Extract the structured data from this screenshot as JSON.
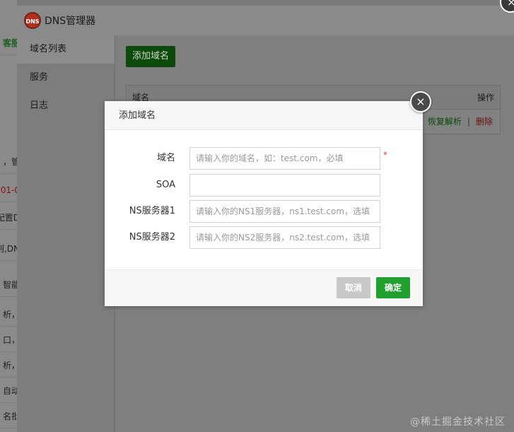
{
  "bg_page": {
    "fragments": [
      "客服",
      "，管",
      "01-0",
      "配置D",
      "则,DN",
      "智能",
      "析，",
      "口，",
      "析，",
      "自动",
      "名批"
    ]
  },
  "window": {
    "logo_text": "DNS",
    "title": "DNS管理器"
  },
  "sidebar": {
    "items": [
      {
        "label": "域名列表"
      },
      {
        "label": "服务"
      },
      {
        "label": "日志"
      }
    ]
  },
  "content": {
    "add_domain_label": "添加域名",
    "table": {
      "col_domain": "域名",
      "col_action": "操作",
      "row_restore": "恢复解析",
      "row_sep": "|",
      "row_delete": "删除"
    }
  },
  "modal": {
    "title": "添加域名",
    "close_glyph": "×",
    "fields": {
      "domain_label": "域名",
      "domain_placeholder": "请输入你的域名，如：test.com，必填",
      "required_mark": "*",
      "soa_label": "SOA",
      "soa_placeholder": "",
      "ns1_label": "NS服务器1",
      "ns1_placeholder": "请输入你的NS1服务器，ns1.test.com，选填",
      "ns2_label": "NS服务器2",
      "ns2_placeholder": "请输入你的NS2服务器，ns2.test.com，选填"
    },
    "cancel_label": "取消",
    "confirm_label": "确定"
  },
  "watermark": "@稀土掘金技术社区",
  "colors": {
    "confirm": "#21a02f",
    "required": "#e04040"
  }
}
